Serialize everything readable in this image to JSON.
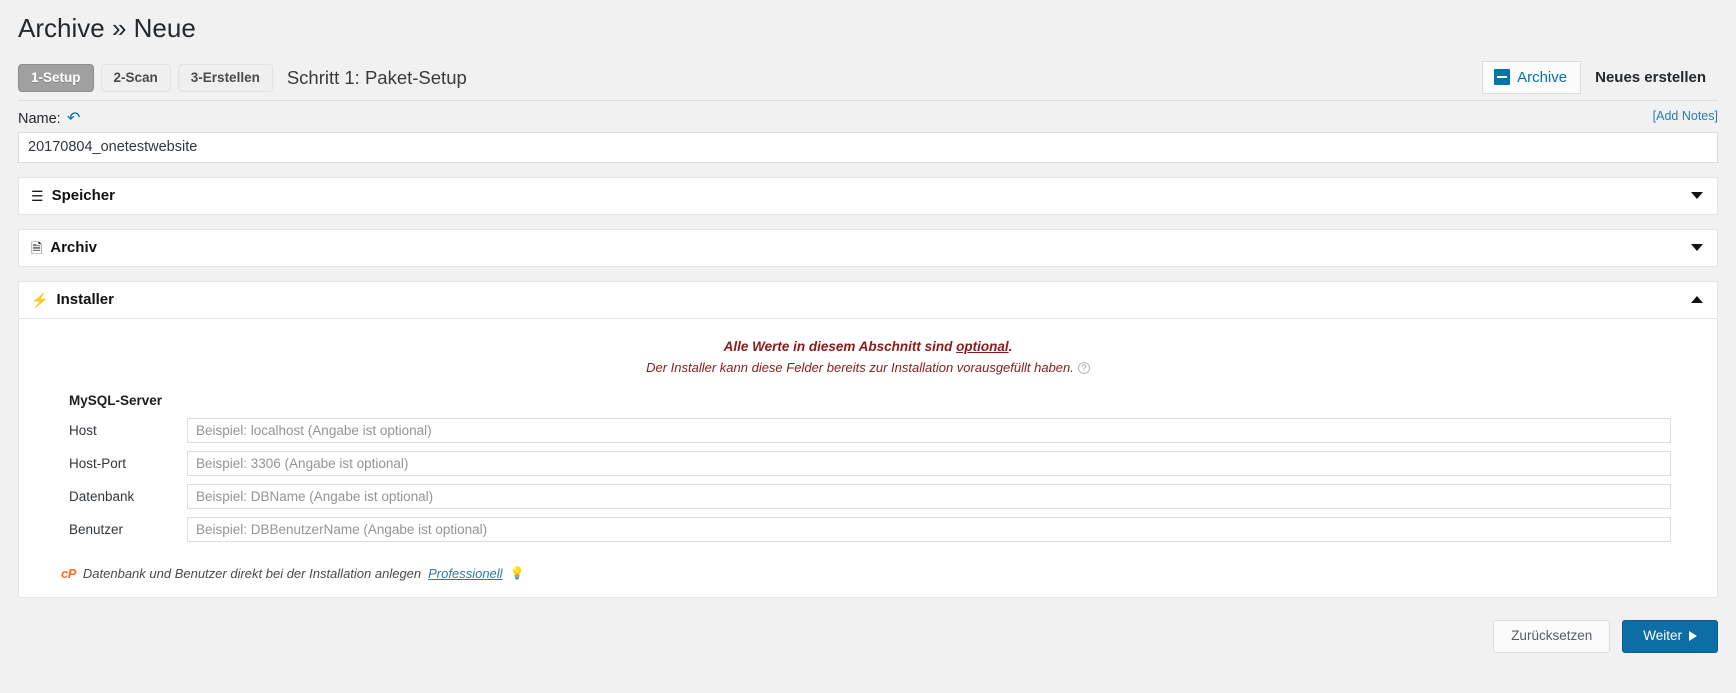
{
  "header": {
    "breadcrumb_root": "Archive",
    "breadcrumb_sep": "»",
    "breadcrumb_current": "Neue"
  },
  "steps": [
    {
      "label": "1-Setup",
      "active": true
    },
    {
      "label": "2-Scan",
      "active": false
    },
    {
      "label": "3-Erstellen",
      "active": false
    }
  ],
  "step_heading": "Schritt 1: Paket-Setup",
  "top_tabs": {
    "archive_label": "Archive",
    "archive_icon": "archive-box-icon",
    "create_new_label": "Neues erstellen"
  },
  "name_section": {
    "label": "Name:",
    "reset_icon": "reset-arrow-icon",
    "value": "20170804_onetestwebsite",
    "add_notes_label": "[Add Notes]"
  },
  "accordions": [
    {
      "title": "Speicher",
      "icon": "database-icon",
      "glyph": "☰",
      "expanded": false
    },
    {
      "title": "Archiv",
      "icon": "zip-file-icon",
      "glyph": "🗎",
      "expanded": false
    },
    {
      "title": "Installer",
      "icon": "lightning-bolt-icon",
      "glyph": "⚡",
      "expanded": true
    }
  ],
  "installer": {
    "notice_bold_prefix": "Alle Werte in diesem Abschnitt sind ",
    "notice_bold_underline": "optional",
    "notice_bold_suffix": ".",
    "notice_sub": "Der Installer kann diese Felder bereits zur Installation vorausgefüllt haben.",
    "help_icon": "question-mark-icon",
    "help_glyph": "?",
    "group_title": "MySQL-Server",
    "fields": [
      {
        "label": "Host",
        "value": "",
        "placeholder": "Beispiel: localhost (Angabe ist optional)"
      },
      {
        "label": "Host-Port",
        "value": "",
        "placeholder": "Beispiel: 3306 (Angabe ist optional)"
      },
      {
        "label": "Datenbank",
        "value": "",
        "placeholder": "Beispiel: DBName (Angabe ist optional)"
      },
      {
        "label": "Benutzer",
        "value": "",
        "placeholder": "Beispiel: DBBenutzerName (Angabe ist optional)"
      }
    ],
    "cpanel": {
      "logo_text": "cP",
      "logo_icon": "cpanel-icon",
      "text": "Datenbank und Benutzer direkt bei der Installation anlegen",
      "link": "Professionell",
      "bulb_icon": "lightbulb-icon",
      "bulb_glyph": "💡"
    }
  },
  "footer": {
    "reset_label": "Zurücksetzen",
    "next_label": "Weiter"
  },
  "colors": {
    "accent": "#0073aa",
    "primary_button": "#0c6ea4",
    "notice_red": "#8b1a1a",
    "cpanel_orange": "#ff6c2c",
    "active_step": "#a0a0a0"
  }
}
